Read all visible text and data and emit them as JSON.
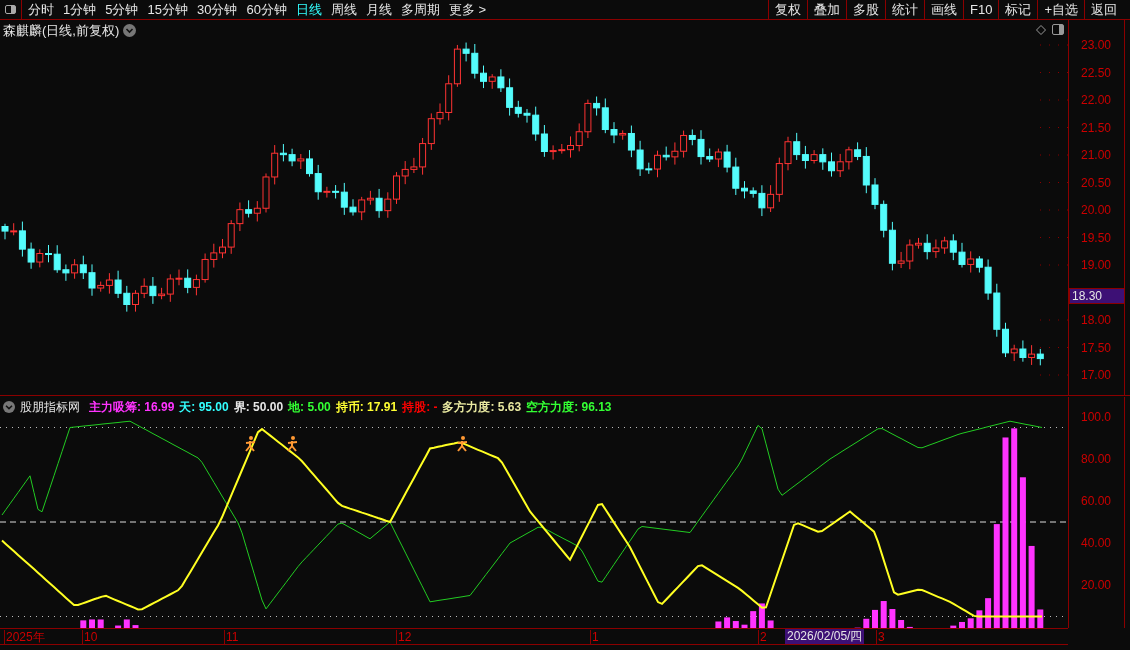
{
  "toolbar": {
    "periods": [
      {
        "label": "分时",
        "selected": false
      },
      {
        "label": "1分钟",
        "selected": false
      },
      {
        "label": "5分钟",
        "selected": false
      },
      {
        "label": "15分钟",
        "selected": false
      },
      {
        "label": "30分钟",
        "selected": false
      },
      {
        "label": "60分钟",
        "selected": false
      },
      {
        "label": "日线",
        "selected": true
      },
      {
        "label": "周线",
        "selected": false
      },
      {
        "label": "月线",
        "selected": false
      },
      {
        "label": "多周期",
        "selected": false
      },
      {
        "label": "更多 >",
        "selected": false
      }
    ],
    "buttons": [
      "复权",
      "叠加",
      "多股",
      "统计",
      "画线",
      "F10",
      "标记",
      "+自选",
      "返回"
    ]
  },
  "price_chart": {
    "title": "森麒麟(日线,前复权)",
    "axis_ticks": [
      "23.00",
      "22.50",
      "22.00",
      "21.50",
      "21.00",
      "20.50",
      "20.00",
      "19.50",
      "19.00",
      "18.00",
      "17.50",
      "17.00"
    ],
    "current_price": "18.30"
  },
  "indicator": {
    "name": "股朋指标网",
    "legend": [
      {
        "label": "主力吸筹: 16.99",
        "color": "#ff33ff"
      },
      {
        "label": "天: 95.00",
        "color": "#33ffff"
      },
      {
        "label": "界: 50.00",
        "color": "#e6e6e6"
      },
      {
        "label": "地: 5.00",
        "color": "#33ff33"
      },
      {
        "label": "持币: 17.91",
        "color": "#ffff33"
      },
      {
        "label": "持股: -",
        "color": "#ff0000"
      },
      {
        "label": "多方力度: 5.63",
        "color": "#e8e8a0"
      },
      {
        "label": "空方力度: 96.13",
        "color": "#33ff33"
      }
    ],
    "axis_ticks": [
      "100.0",
      "80.00",
      "60.00",
      "40.00",
      "20.00"
    ]
  },
  "time_axis": {
    "labels": [
      "2025年",
      "10",
      "11",
      "12",
      "1",
      "2",
      "3"
    ],
    "cursor_date": "2026/02/05/四"
  }
}
